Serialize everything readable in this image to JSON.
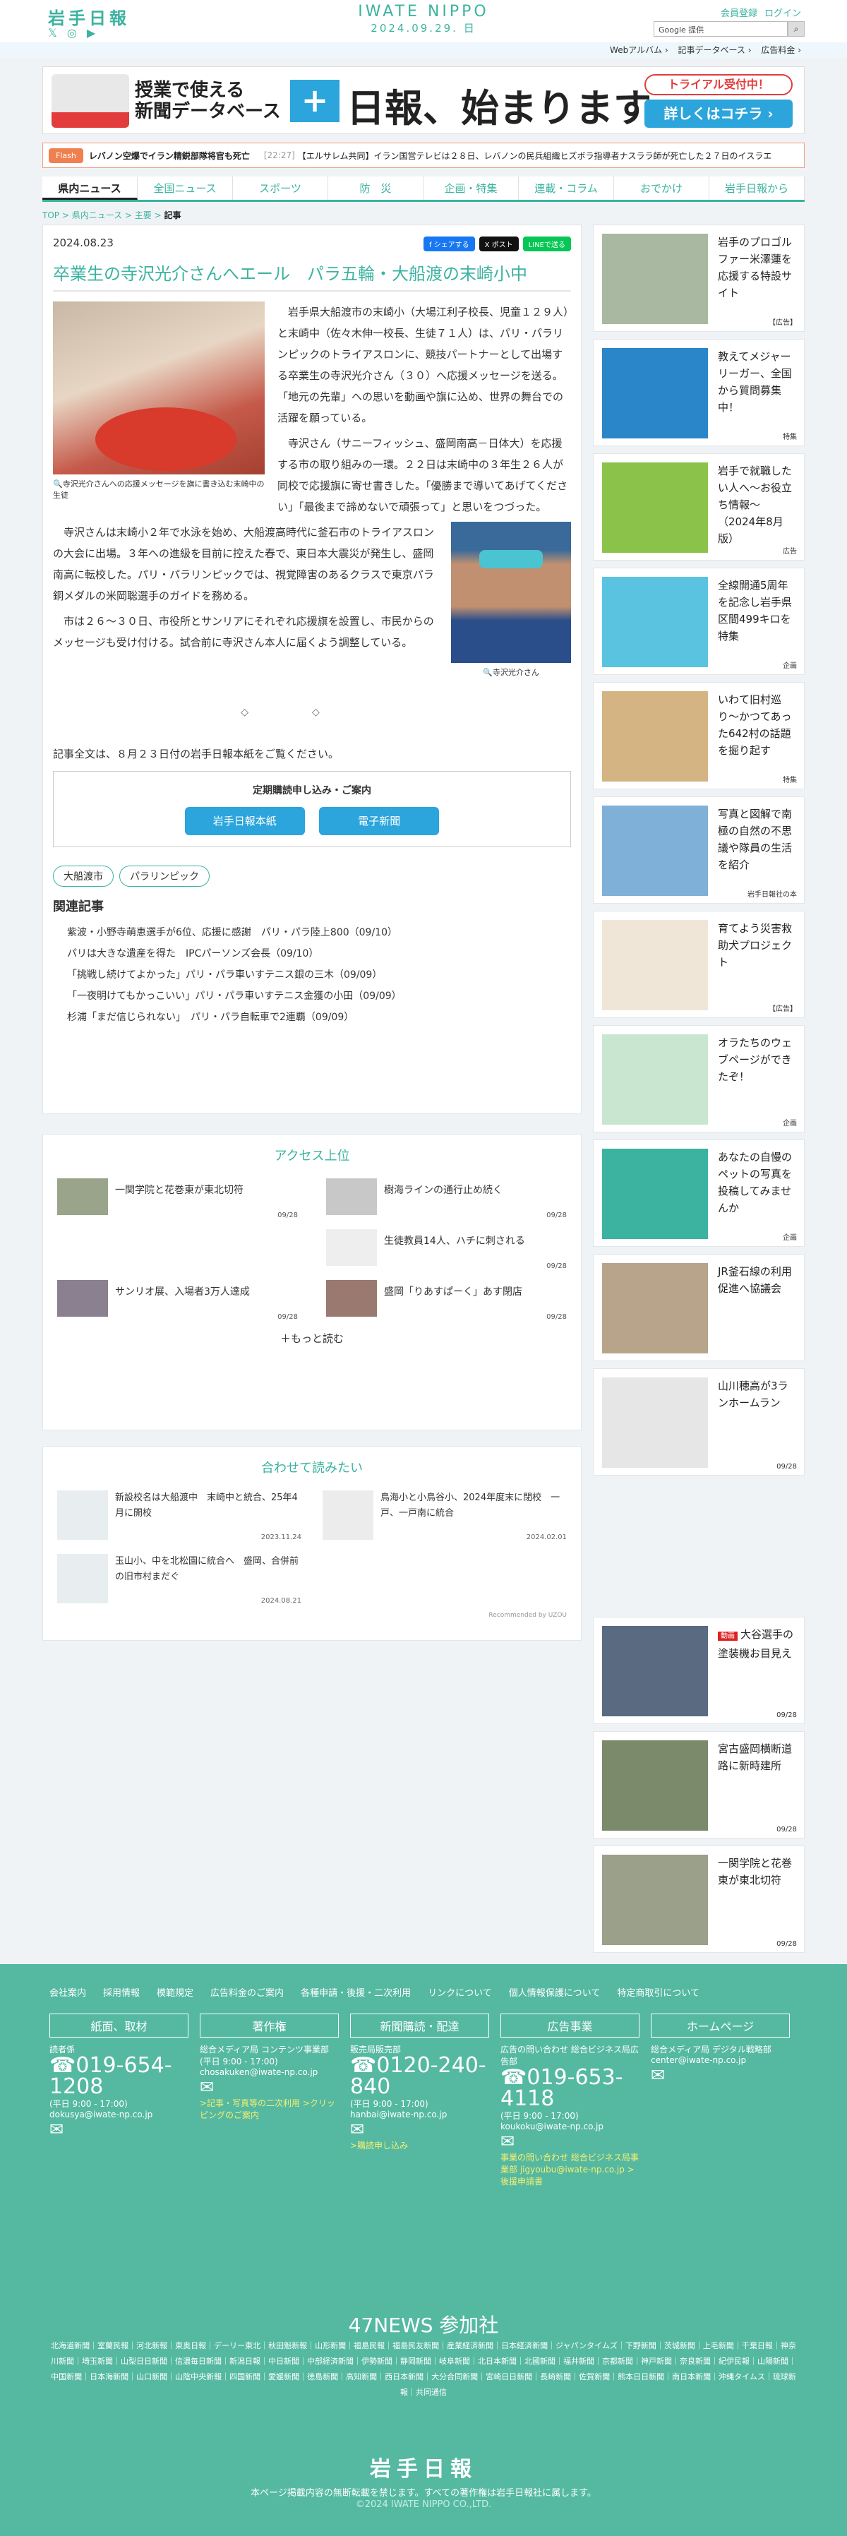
{
  "header": {
    "logo_jp": "岩手日報",
    "logo_en": "IWATE NIPPO",
    "date": "2024.09.29. 日",
    "member_register": "会員登録",
    "login": "ログイン",
    "search_placeholder": "Google 提供",
    "sublinks": [
      "Webアルバム ›",
      "記事データベース ›",
      "広告料金 ›"
    ]
  },
  "banner": {
    "title_a": "授業で使える",
    "title_b": "新聞データベース",
    "plus": "+",
    "title_c": "日報、始まります。",
    "trial": "トライアル受付中！",
    "detail": "詳しくはコチラ ›"
  },
  "flash": {
    "label": "Flash",
    "items": [
      {
        "time": "",
        "text": "レバノン空爆でイラン精鋭部隊将官も死亡"
      },
      {
        "time": "[22:27]",
        "text": "【エルサレム共同】イラン国営テレビは２８日、レバノンの民兵組織ヒズボラ指導者ナスララ師が死亡した２７日のイスラエ"
      }
    ]
  },
  "nav": [
    "県内ニュース",
    "全国ニュース",
    "スポーツ",
    "防　災",
    "企画・特集",
    "連載・コラム",
    "おでかけ",
    "岩手日報から"
  ],
  "breadcrumb": {
    "top": "TOP",
    "a": "県内ニュース",
    "b": "主要",
    "cur": "記事"
  },
  "article": {
    "date": "2024.08.23",
    "share_fb": "f シェアする",
    "share_x": "X ポスト",
    "share_line": "LINEで送る",
    "title": "卒業生の寺沢光介さんへエール　パラ五輪・大船渡の末崎小中",
    "caption1": "寺沢光介さんへの応援メッセージを旗に書き込む末崎中の生徒",
    "caption2": "寺沢光介さん",
    "para1": "岩手県大船渡市の末崎小（大場江利子校長、児童１２９人）と末崎中（佐々木伸一校長、生徒７１人）は、パリ・パラリンピックのトライアスロンに、競技パートナーとして出場する卒業生の寺沢光介さん（３０）へ応援メッセージを送る。「地元の先輩」への思いを動画や旗に込め、世界の舞台での活躍を願っている。",
    "para2": "寺沢さん（サニーフィッシュ、盛岡南高－日体大）を応援する市の取り組みの一環。２２日は末崎中の３年生２６人が同校で応援旗に寄せ書きした。「優勝まで導いてあげてください」「最後まで諦めないで頑張って」と思いをつづった。",
    "para3": "寺沢さんは末崎小２年で水泳を始め、大船渡高時代に釜石市のトライアスロンの大会に出場。３年への進級を目前に控えた春で、東日本大震災が発生し、盛岡南高に転校した。パリ・パラリンピックでは、視覚障害のあるクラスで東京パラ銅メダルの米岡聡選手のガイドを務める。",
    "para4": "市は２６～３０日、市役所とサンリアにそれぞれ応援旗を設置し、市民からのメッセージも受け付ける。試合前に寺沢さん本人に届くよう調整している。",
    "dots": "◇◇",
    "tail": "記事全文は、８月２３日付の岩手日報本紙をご覧ください。",
    "sub_title": "定期購読申し込み・ご案内",
    "sub_btn1": "岩手日報本紙",
    "sub_btn2": "電子新聞",
    "tags": [
      "大船渡市",
      "パラリンピック"
    ],
    "related_title": "関連記事",
    "related": [
      "紫波・小野寺萌恵選手が6位、応援に感謝　パリ・パラ陸上800（09/10）",
      "パリは大きな遺産を得た　IPCパーソンズ会長（09/10）",
      "「挑戦し続けてよかった」パリ・パラ車いすテニス銀の三木（09/09）",
      "「一夜明けてもかっこいい」パリ・パラ車いすテニス金獲の小田（09/09）",
      "杉浦「まだ信じられない」　パリ・パラ自転車で2連覇（09/09）"
    ]
  },
  "ranking": {
    "title": "アクセス上位",
    "items": [
      {
        "text": "一関学院と花巻東が東北切符",
        "date": "09/28"
      },
      {
        "text": "樹海ラインの通行止め続く",
        "date": "09/28"
      },
      {
        "text": "",
        "date": ""
      },
      {
        "text": "生徒教員14人、ハチに刺される",
        "date": "09/28"
      },
      {
        "text": "サンリオ展、入場者3万人達成",
        "date": "09/28"
      },
      {
        "text": "盛岡「りあすぱーく」あす閉店",
        "date": "09/28"
      }
    ],
    "more": "もっと読む"
  },
  "also": {
    "title": "合わせて読みたい",
    "items": [
      {
        "text": "新設校名は大船渡中　末崎中と統合、25年4月に開校",
        "date": "2023.11.24"
      },
      {
        "text": "鳥海小と小鳥谷小、2024年度末に閉校　一戸、一戸南に統合",
        "date": "2024.02.01"
      },
      {
        "text": "玉山小、中を北松園に統合へ　盛岡、合併前の旧市村まだぐ",
        "date": "2024.08.21"
      }
    ],
    "recommended": "Recommended by UZOU"
  },
  "sidebar": [
    {
      "text": "岩手のプロゴルファー米澤蓮を応援する特設サイト",
      "label": "【広告】",
      "color": "#a9b8a0"
    },
    {
      "text": "教えてメジャーリーガー、全国から質問募集中！",
      "label": "特集",
      "color": "#2a86c8"
    },
    {
      "text": "岩手で就職したい人へ〜お役立ち情報〜（2024年8月版）",
      "label": "広告",
      "color": "#8bc34a"
    },
    {
      "text": "全線開通5周年を記念し岩手県区間499キロを特集",
      "label": "企画",
      "color": "#5ac4e0"
    },
    {
      "text": "いわて旧村巡り〜かつてあった642村の話題を掘り起す",
      "label": "特集",
      "color": "#d4b483"
    },
    {
      "text": "写真と図解で南極の自然の不思議や隊員の生活を紹介",
      "label": "岩手日報社の本",
      "color": "#7fb0d8"
    },
    {
      "text": "育てよう災害救助犬プロジェクト",
      "label": "【広告】",
      "color": "#f0e6d8"
    },
    {
      "text": "オラたちのウェブページができたぞ！",
      "label": "企画",
      "color": "#c9e6d0"
    },
    {
      "text": "あなたの自慢のペットの写真を投稿してみませんか",
      "label": "企画",
      "color": "#3bb3a0"
    },
    {
      "text": "JR釜石線の利用促進へ協議会",
      "label": "",
      "color": "#b7a48a"
    },
    {
      "text": "山川穂高が3ランホームラン",
      "label": "09/28",
      "color": "#e6e6e6"
    },
    {
      "text": "動画 大谷選手の塗装機お目見え",
      "label": "09/28",
      "color": "#5a6a80"
    },
    {
      "text": "宮古盛岡横断道路に新時建所",
      "label": "09/28",
      "color": "#7a8a6a"
    },
    {
      "text": "一関学院と花巻東が東北切符",
      "label": "09/28",
      "color": "#9aa08a"
    }
  ],
  "footer": {
    "links": [
      "会社案内",
      "採用情報",
      "模範規定",
      "広告料金のご案内",
      "各種申請・後援・二次利用",
      "リンクについて",
      "個人情報保護について",
      "特定商取引について"
    ],
    "cols": [
      {
        "h": "紙面、取材",
        "l1": "読者係",
        "tel": "019-654-1208",
        "hours": "(平日 9:00 - 17:00)",
        "mail": "dokusya@iwate-np.co.jp",
        "extra": ""
      },
      {
        "h": "著作権",
        "l1": "総合メディア局 コンテンツ事業部",
        "tel": "",
        "hours": "(平日 9:00 - 17:00)",
        "mail": "chosakuken@iwate-np.co.jp",
        "extra": ">記事・写真等の二次利用 >クリッピングのご案内"
      },
      {
        "h": "新聞購読・配達",
        "l1": "販売局販売部",
        "tel": "0120-240-840",
        "hours": "(平日 9:00 - 17:00)",
        "mail": "hanbai@iwate-np.co.jp",
        "extra": ">購読申し込み"
      },
      {
        "h": "広告事業",
        "l1": "広告の問い合わせ 総合ビジネス局広告部",
        "tel": "019-653-4118",
        "hours": "(平日 9:00 - 17:00)",
        "mail": "koukoku@iwate-np.co.jp",
        "extra": "事業の問い合わせ 総合ビジネス局事業部 jigyoubu@iwate-np.co.jp >後援申請書"
      },
      {
        "h": "ホームページ",
        "l1": "総合メディア局 デジタル戦略部",
        "tel": "",
        "hours": "",
        "mail": "center@iwate-np.co.jp",
        "extra": ""
      }
    ],
    "title_47": "47NEWS 参加社",
    "media": "北海道新聞｜室蘭民報｜河北新報｜東奥日報｜デーリー東北｜秋田魁新報｜山形新聞｜福島民報｜福島民友新聞｜産業経済新聞｜日本経済新聞｜ジャパンタイムズ｜下野新聞｜茨城新聞｜上毛新聞｜千葉日報｜神奈川新聞｜埼玉新聞｜山梨日日新聞｜信濃毎日新聞｜新潟日報｜中日新聞｜中部経済新聞｜伊勢新聞｜静岡新聞｜岐阜新聞｜北日本新聞｜北國新聞｜福井新聞｜京都新聞｜神戸新聞｜奈良新聞｜紀伊民報｜山陽新聞｜中国新聞｜日本海新聞｜山口新聞｜山陰中央新報｜四国新聞｜愛媛新聞｜徳島新聞｜高知新聞｜西日本新聞｜大分合同新聞｜宮崎日日新聞｜長崎新聞｜佐賀新聞｜熊本日日新聞｜南日本新聞｜沖縄タイムス｜琉球新報｜共同通信",
    "logo": "岩手日報",
    "copy": "本ページ掲載内容の無断転載を禁じます。すべての著作権は岩手日報社に属します。",
    "copy2": "©2024 IWATE NIPPO CO.,LTD."
  }
}
